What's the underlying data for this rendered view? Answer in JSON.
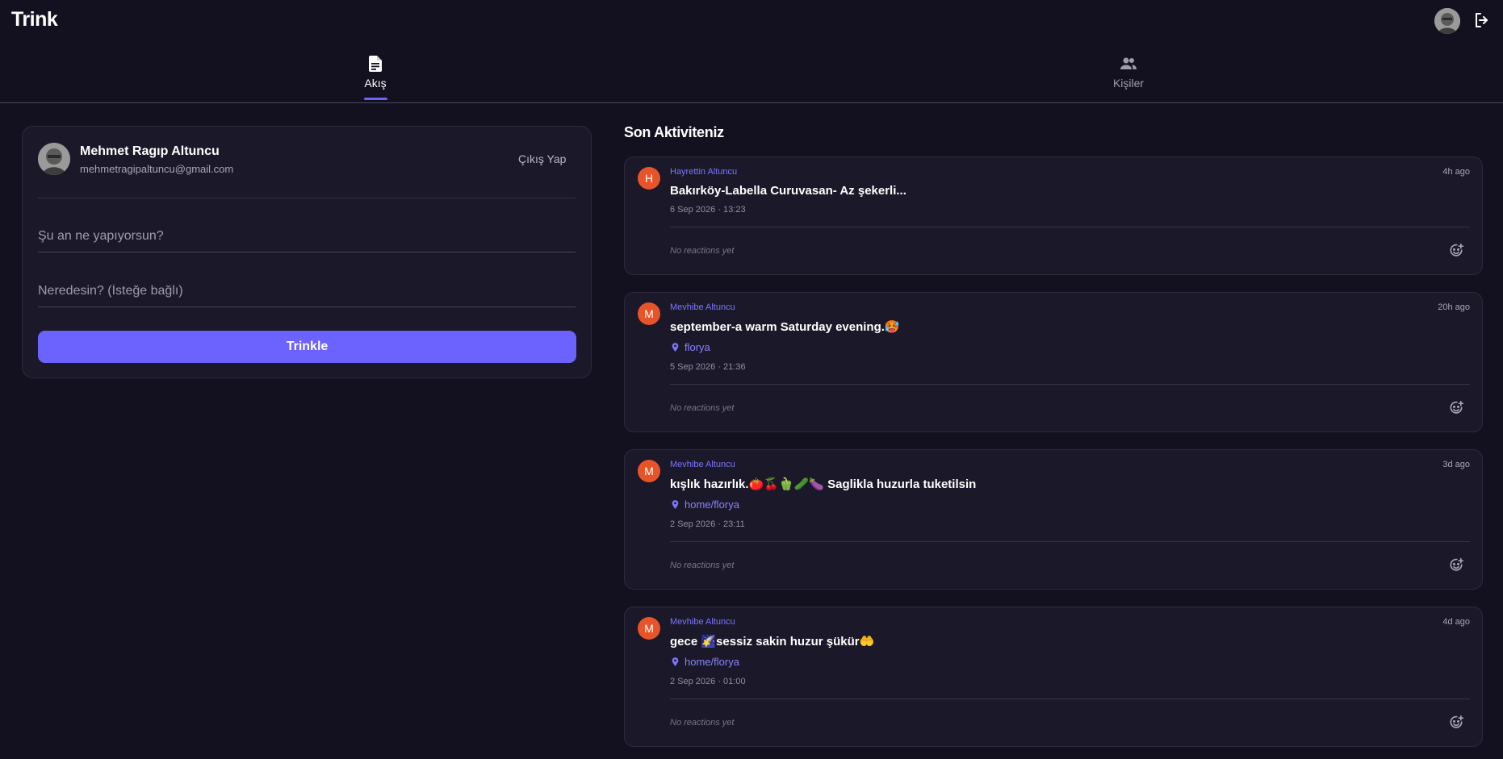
{
  "app": {
    "title": "Trink"
  },
  "tabs": [
    {
      "label": "Akış",
      "icon": "article-icon",
      "active": true
    },
    {
      "label": "Kişiler",
      "icon": "people-icon",
      "active": false
    }
  ],
  "compose": {
    "user_name": "Mehmet Ragıp Altuncu",
    "user_email": "mehmetragipaltuncu@gmail.com",
    "signout_label": "Çıkış Yap",
    "what_placeholder": "Şu an ne yapıyorsun?",
    "where_placeholder": "Neredesin? (İsteğe bağlı)",
    "submit_label": "Trinkle"
  },
  "activity": {
    "title": "Son Aktiviteniz",
    "posts": [
      {
        "initial": "H",
        "author": "Hayrettin Altuncu",
        "time_ago": "4h ago",
        "text": "Bakırköy-Labella Curuvasan- Az şekerli...",
        "location": "",
        "date": "6 Sep 2026 · 13:23",
        "reactions": "No reactions yet"
      },
      {
        "initial": "M",
        "author": "Mevhibe Altuncu",
        "time_ago": "20h ago",
        "text": "september-a warm Saturday evening.🥵",
        "location": "florya",
        "date": "5 Sep 2026 · 21:36",
        "reactions": "No reactions yet"
      },
      {
        "initial": "M",
        "author": "Mevhibe Altuncu",
        "time_ago": "3d ago",
        "text": "kışlık hazırlık.🍅🍒🫑🥒🍆 Saglikla huzurla tuketilsin",
        "location": "home/florya",
        "date": "2 Sep 2026 · 23:11",
        "reactions": "No reactions yet"
      },
      {
        "initial": "M",
        "author": "Mevhibe Altuncu",
        "time_ago": "4d ago",
        "text": "gece 🌠sessiz sakin huzur şükür🤲",
        "location": "home/florya",
        "date": "2 Sep 2026 · 01:00",
        "reactions": "No reactions yet"
      }
    ]
  },
  "colors": {
    "accent": "#6c63ff",
    "avatar_bg": "#e8542a",
    "background": "#13111f",
    "card": "#1b1929"
  }
}
